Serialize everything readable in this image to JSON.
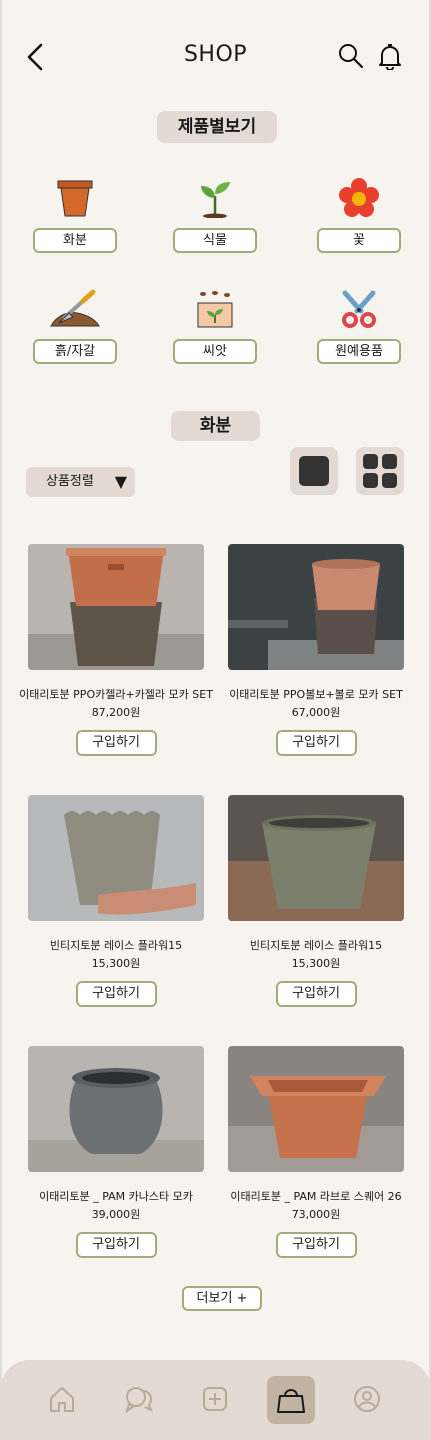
{
  "header": {
    "title": "SHOP"
  },
  "categories_heading": "제품별보기",
  "categories": [
    {
      "label": "화분",
      "icon": "flower-pot-icon"
    },
    {
      "label": "식물",
      "icon": "sprout-icon"
    },
    {
      "label": "꽃",
      "icon": "flower-icon"
    },
    {
      "label": "흙/자갈",
      "icon": "trowel-soil-icon"
    },
    {
      "label": "씨앗",
      "icon": "seeds-icon"
    },
    {
      "label": "원예용품",
      "icon": "pruning-shears-icon"
    }
  ],
  "section_title": "화분",
  "sort": {
    "label": "상품정렬",
    "arrow": "▼"
  },
  "products": [
    {
      "name": "이태리토분 PPO카젤라+카젤라 모카 SET",
      "price": "87,200원",
      "buy_label": "구입하기"
    },
    {
      "name": "이태리토분 PPO볼보+볼로 모카 SET",
      "price": "67,000원",
      "buy_label": "구입하기"
    },
    {
      "name": "빈티지토분 레이스 플라워15",
      "price": "15,300원",
      "buy_label": "구입하기"
    },
    {
      "name": "빈티지토분 레이스 플라워15",
      "price": "15,300원",
      "buy_label": "구입하기"
    },
    {
      "name": "이태리토분 _ PAM 카나스타 모카",
      "price": "39,000원",
      "buy_label": "구입하기"
    },
    {
      "name": "이태리토분 _ PAM 라브로 스퀘어 26",
      "price": "73,000원",
      "buy_label": "구입하기"
    }
  ],
  "more_label": "더보기 +",
  "tabbar": {
    "items": [
      "home-icon",
      "chat-icon",
      "plus-icon",
      "shopping-bag-icon",
      "profile-icon"
    ],
    "active": "shopping-bag-icon"
  },
  "colors": {
    "background": "#f7f3ef",
    "pill": "#e2dad3",
    "accent_border": "#a3ab7c",
    "active_tab": "#c1b4a5"
  }
}
